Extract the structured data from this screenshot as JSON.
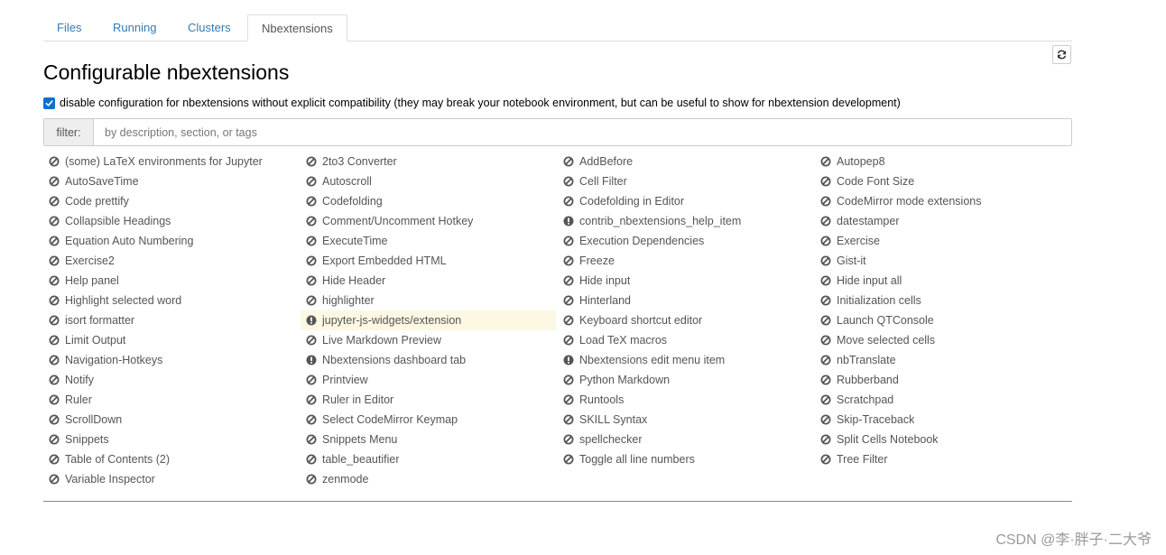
{
  "tabs": [
    {
      "label": "Files"
    },
    {
      "label": "Running"
    },
    {
      "label": "Clusters"
    },
    {
      "label": "Nbextensions",
      "active": true
    }
  ],
  "title": "Configurable nbextensions",
  "compat": {
    "checked": true,
    "label": "disable configuration for nbextensions without explicit compatibility (they may break your notebook environment, but can be useful to show for nbextension development)"
  },
  "filter": {
    "label": "filter:",
    "placeholder": "by description, section, or tags",
    "value": ""
  },
  "icons": {
    "disabled": "ban-icon",
    "warning": "exclamation-circle-icon",
    "refresh": "refresh-icon"
  },
  "colors": {
    "icon": "#555555",
    "selected_bg": "#fcf8e3",
    "link": "#337ab7"
  },
  "columns": [
    [
      {
        "label": "(some) LaTeX environments for Jupyter",
        "icon": "ban"
      },
      {
        "label": "AutoSaveTime",
        "icon": "ban"
      },
      {
        "label": "Code prettify",
        "icon": "ban"
      },
      {
        "label": "Collapsible Headings",
        "icon": "ban"
      },
      {
        "label": "Equation Auto Numbering",
        "icon": "ban"
      },
      {
        "label": "Exercise2",
        "icon": "ban"
      },
      {
        "label": "Help panel",
        "icon": "ban"
      },
      {
        "label": "Highlight selected word",
        "icon": "ban"
      },
      {
        "label": "isort formatter",
        "icon": "ban"
      },
      {
        "label": "Limit Output",
        "icon": "ban"
      },
      {
        "label": "Navigation-Hotkeys",
        "icon": "ban"
      },
      {
        "label": "Notify",
        "icon": "ban"
      },
      {
        "label": "Ruler",
        "icon": "ban"
      },
      {
        "label": "ScrollDown",
        "icon": "ban"
      },
      {
        "label": "Snippets",
        "icon": "ban"
      },
      {
        "label": "Table of Contents (2)",
        "icon": "ban"
      },
      {
        "label": "Variable Inspector",
        "icon": "ban"
      }
    ],
    [
      {
        "label": "2to3 Converter",
        "icon": "ban"
      },
      {
        "label": "Autoscroll",
        "icon": "ban"
      },
      {
        "label": "Codefolding",
        "icon": "ban"
      },
      {
        "label": "Comment/Uncomment Hotkey",
        "icon": "ban"
      },
      {
        "label": "ExecuteTime",
        "icon": "ban"
      },
      {
        "label": "Export Embedded HTML",
        "icon": "ban"
      },
      {
        "label": "Hide Header",
        "icon": "ban"
      },
      {
        "label": "highlighter",
        "icon": "ban"
      },
      {
        "label": "jupyter-js-widgets/extension",
        "icon": "warning",
        "selected": true
      },
      {
        "label": "Live Markdown Preview",
        "icon": "ban"
      },
      {
        "label": "Nbextensions dashboard tab",
        "icon": "warning"
      },
      {
        "label": "Printview",
        "icon": "ban"
      },
      {
        "label": "Ruler in Editor",
        "icon": "ban"
      },
      {
        "label": "Select CodeMirror Keymap",
        "icon": "ban"
      },
      {
        "label": "Snippets Menu",
        "icon": "ban"
      },
      {
        "label": "table_beautifier",
        "icon": "ban"
      },
      {
        "label": "zenmode",
        "icon": "ban"
      }
    ],
    [
      {
        "label": "AddBefore",
        "icon": "ban"
      },
      {
        "label": "Cell Filter",
        "icon": "ban"
      },
      {
        "label": "Codefolding in Editor",
        "icon": "ban"
      },
      {
        "label": "contrib_nbextensions_help_item",
        "icon": "warning"
      },
      {
        "label": "Execution Dependencies",
        "icon": "ban"
      },
      {
        "label": "Freeze",
        "icon": "ban"
      },
      {
        "label": "Hide input",
        "icon": "ban"
      },
      {
        "label": "Hinterland",
        "icon": "ban"
      },
      {
        "label": "Keyboard shortcut editor",
        "icon": "ban"
      },
      {
        "label": "Load TeX macros",
        "icon": "ban"
      },
      {
        "label": "Nbextensions edit menu item",
        "icon": "warning"
      },
      {
        "label": "Python Markdown",
        "icon": "ban"
      },
      {
        "label": "Runtools",
        "icon": "ban"
      },
      {
        "label": "SKILL Syntax",
        "icon": "ban"
      },
      {
        "label": "spellchecker",
        "icon": "ban"
      },
      {
        "label": "Toggle all line numbers",
        "icon": "ban"
      }
    ],
    [
      {
        "label": "Autopep8",
        "icon": "ban"
      },
      {
        "label": "Code Font Size",
        "icon": "ban"
      },
      {
        "label": "CodeMirror mode extensions",
        "icon": "ban"
      },
      {
        "label": "datestamper",
        "icon": "ban"
      },
      {
        "label": "Exercise",
        "icon": "ban"
      },
      {
        "label": "Gist-it",
        "icon": "ban"
      },
      {
        "label": "Hide input all",
        "icon": "ban"
      },
      {
        "label": "Initialization cells",
        "icon": "ban"
      },
      {
        "label": "Launch QTConsole",
        "icon": "ban"
      },
      {
        "label": "Move selected cells",
        "icon": "ban"
      },
      {
        "label": "nbTranslate",
        "icon": "ban"
      },
      {
        "label": "Rubberband",
        "icon": "ban"
      },
      {
        "label": "Scratchpad",
        "icon": "ban"
      },
      {
        "label": "Skip-Traceback",
        "icon": "ban"
      },
      {
        "label": "Split Cells Notebook",
        "icon": "ban"
      },
      {
        "label": "Tree Filter",
        "icon": "ban"
      }
    ]
  ],
  "watermark": "CSDN @李·胖子·二大爷"
}
